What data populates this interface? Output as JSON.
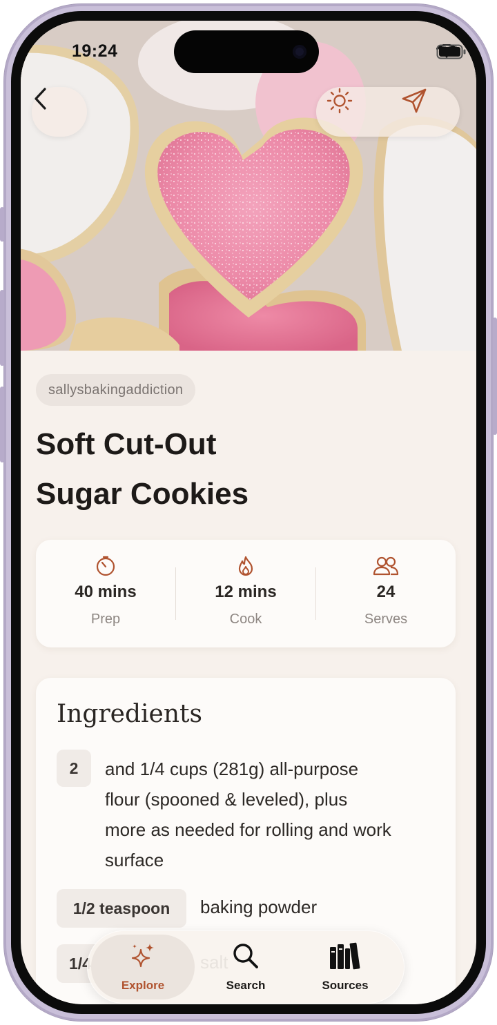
{
  "status_bar": {
    "time": "19:24"
  },
  "source": {
    "name": "sallysbakingaddiction"
  },
  "recipe": {
    "title_line1": "Soft Cut-Out",
    "title_line2": "Sugar Cookies"
  },
  "stats": [
    {
      "icon": "timer-icon",
      "value": "40 mins",
      "label": "Prep"
    },
    {
      "icon": "flame-icon",
      "value": "12 mins",
      "label": "Cook"
    },
    {
      "icon": "people-icon",
      "value": "24",
      "label": "Serves"
    }
  ],
  "ingredients": {
    "title": "Ingredients",
    "items": [
      {
        "qty": "2",
        "line1": "and 1/4 cups (281g) all-purpose",
        "line2": "flour (spooned & leveled), plus",
        "line3": "more as needed for rolling and work",
        "line4": "surface"
      },
      {
        "qty": "1/2 teaspoon",
        "line1": "baking powder"
      },
      {
        "qty": "1/4",
        "line1": "salt"
      }
    ]
  },
  "actions": {
    "back_icon": "chevron-left-icon",
    "theme_icon": "sun-icon",
    "share_icon": "paper-plane-icon"
  },
  "tabs": [
    {
      "label": "Explore",
      "icon": "sparkles-icon",
      "active": true
    },
    {
      "label": "Search",
      "icon": "search-icon",
      "active": false
    },
    {
      "label": "Sources",
      "icon": "books-icon",
      "active": false
    }
  ],
  "colors": {
    "accent": "#b0532f",
    "background": "#f7f1ec",
    "card": "#fdfbf9"
  }
}
